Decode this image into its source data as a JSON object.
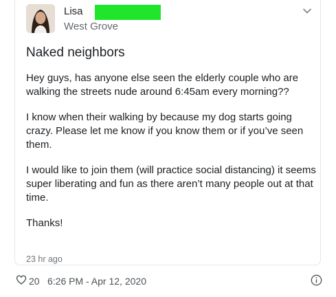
{
  "author": {
    "name": "Lisa",
    "location": "West Grove"
  },
  "post": {
    "title": "Naked neighbors",
    "paragraphs": [
      "Hey guys, has anyone else seen the elderly couple who are walking the streets nude around 6:45am every morning??",
      "I know when their walking by because my dog starts going crazy. Please let me know if you know them or if you’ve seen them.",
      "I would like to join them (will practice social distancing) it seems super liberating and fun as there aren’t many people out at that time.",
      "Thanks!"
    ],
    "timestamp": "23 hr ago"
  },
  "tweet_footer": {
    "likes": "20",
    "datetime": "6:26 PM - Apr 12, 2020"
  },
  "icons": {
    "menu": "chevron-down-icon",
    "like": "heart-icon",
    "info": "info-icon"
  },
  "colors": {
    "redaction": "#1fe52b",
    "text": "#1b1f23",
    "muted": "#62676c"
  }
}
